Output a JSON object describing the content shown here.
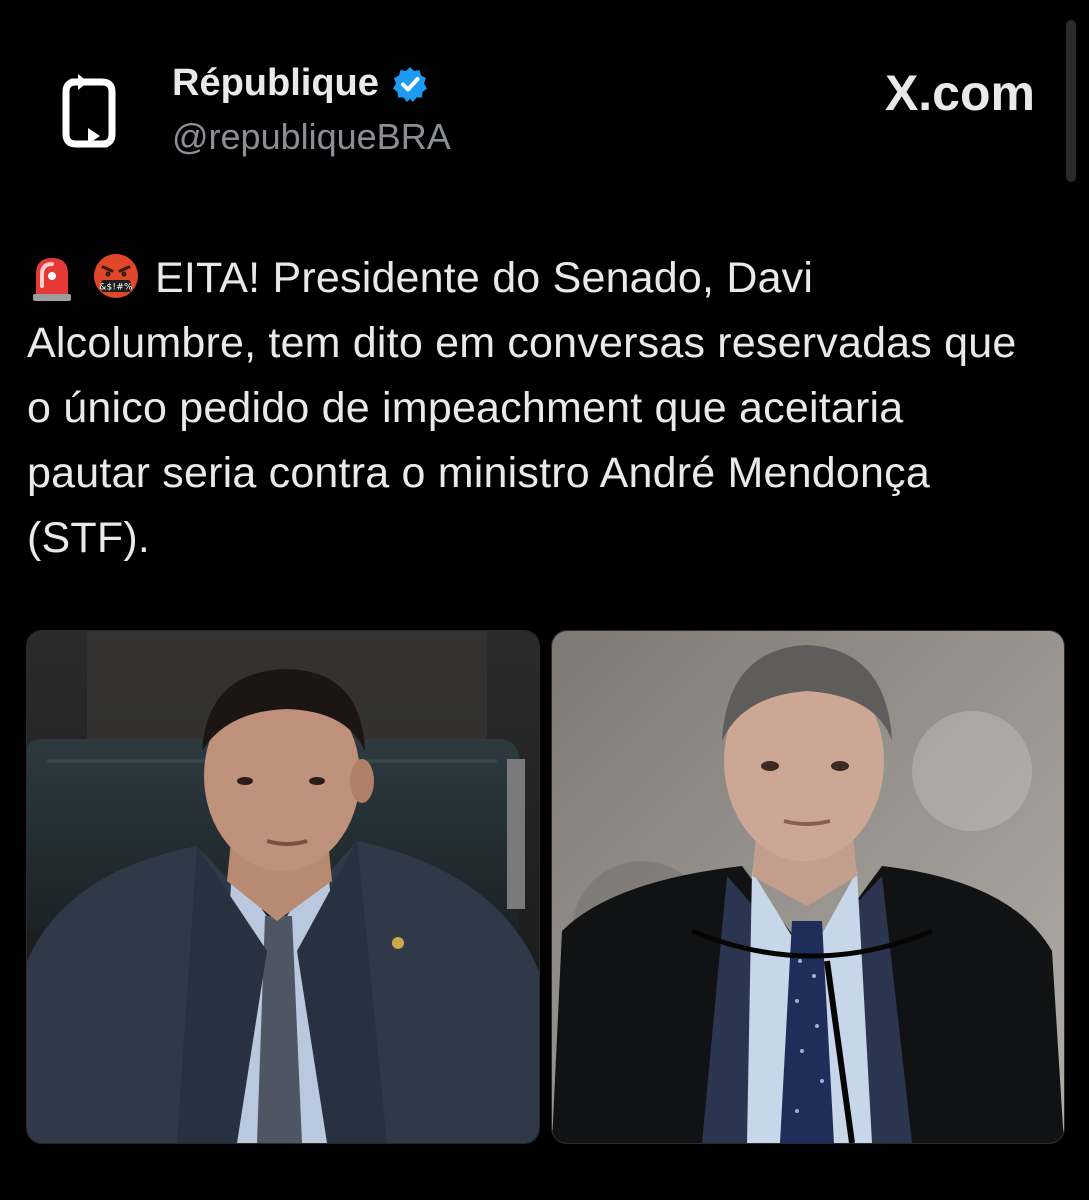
{
  "post": {
    "author_name": "République",
    "author_handle": "@republiqueBRA",
    "source": "X.com",
    "emojis": [
      "rotating-light-emoji",
      "face-with-symbols-on-mouth-emoji"
    ],
    "text": "EITA! Presidente do Senado, Davi Alcolumbre, tem dito em conversas reservadas que o único pedido de impeachment que aceitaria pautar seria contra o ministro André Mendonça (STF).",
    "images": [
      {
        "icon": "photo-man-in-senate-chair"
      },
      {
        "icon": "photo-man-in-judicial-robe"
      }
    ]
  },
  "colors": {
    "background": "#000000",
    "text": "#e7e9ea",
    "secondary_text": "#8b8f94",
    "verified_badge": "#1d9bf0"
  }
}
